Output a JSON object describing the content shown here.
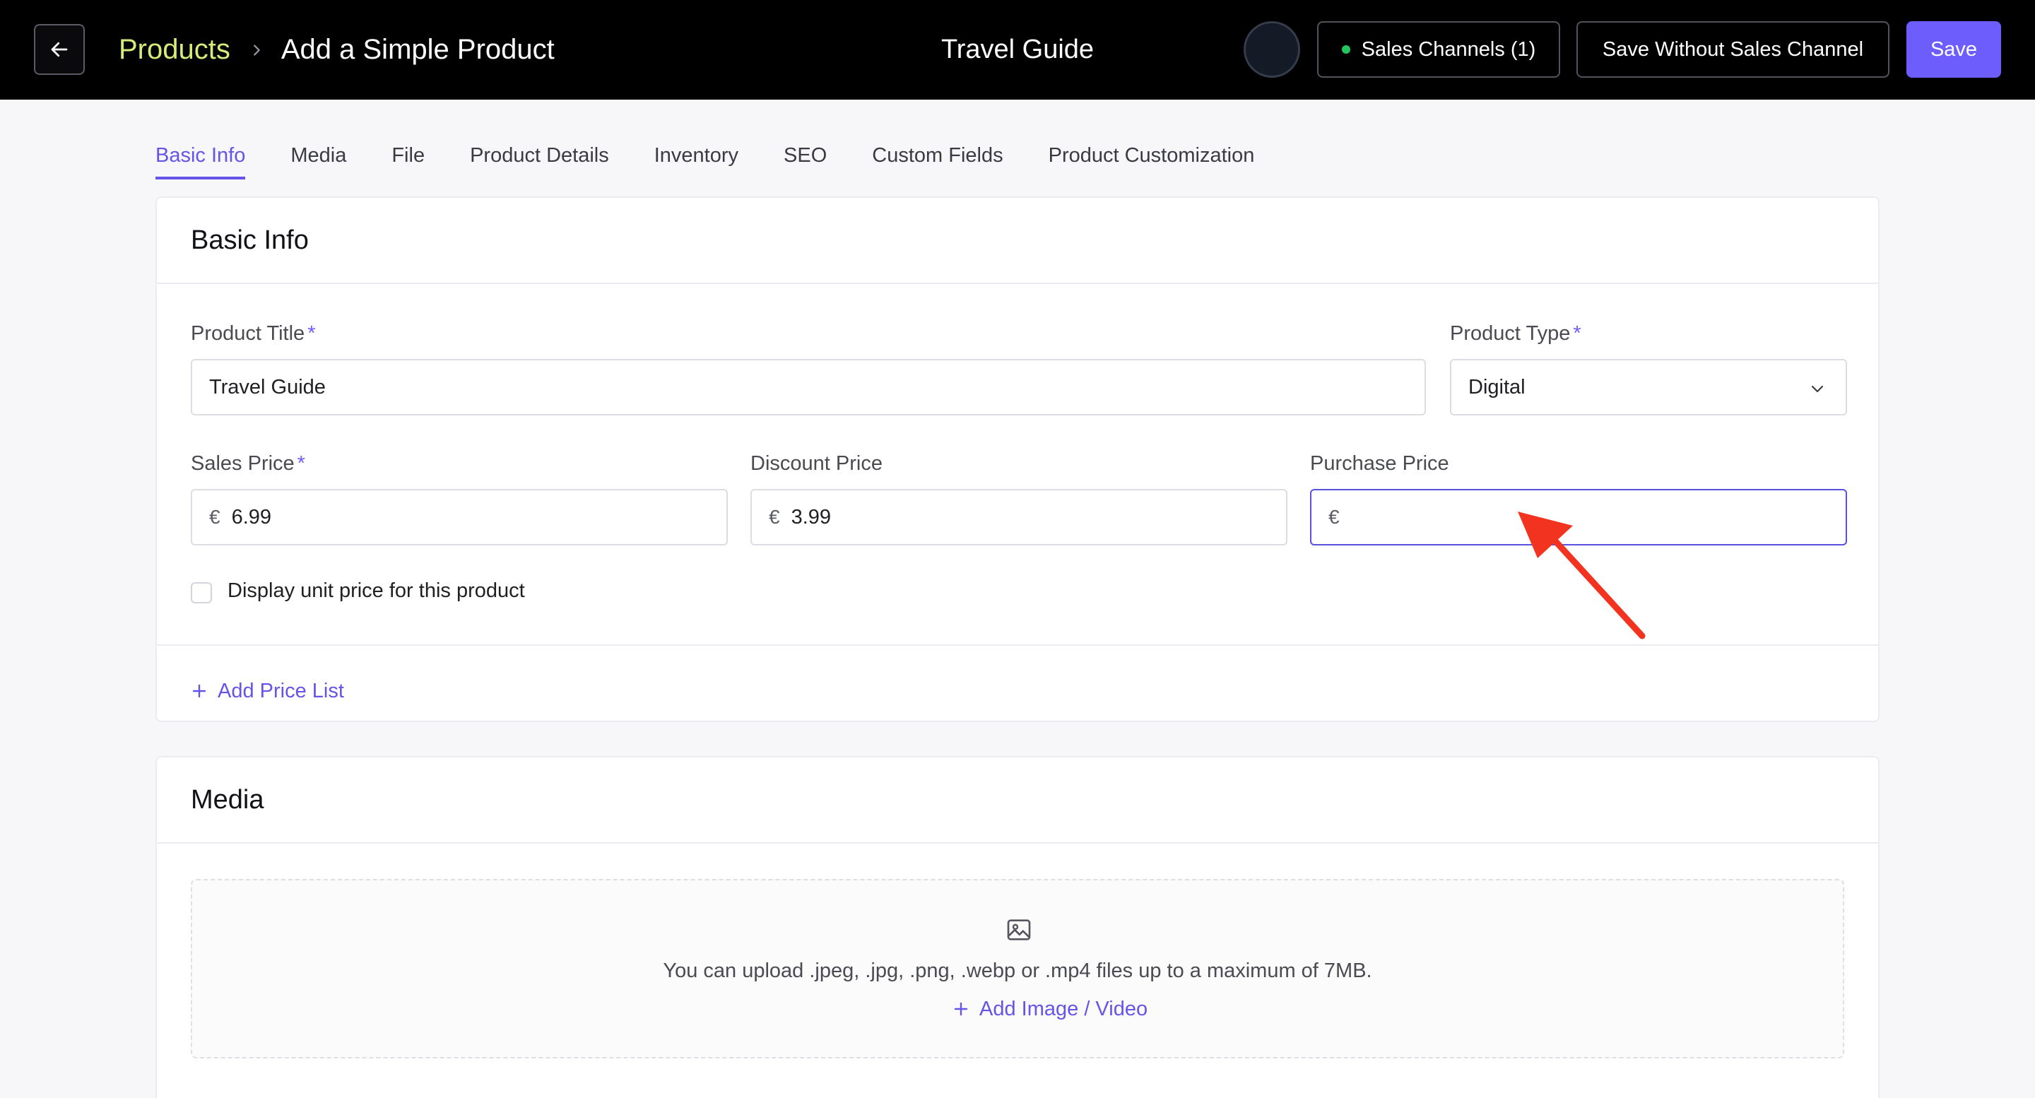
{
  "header": {
    "back_icon": "arrow-left-icon",
    "breadcrumb_parent": "Products",
    "breadcrumb_separator_icon": "chevron-right-icon",
    "breadcrumb_current": "Add a Simple Product",
    "center_title": "Travel Guide",
    "sales_channels_label": "Sales Channels (1)",
    "save_without_label": "Save Without Sales Channel",
    "save_label": "Save"
  },
  "tabs": [
    {
      "label": "Basic Info",
      "active": true
    },
    {
      "label": "Media",
      "active": false
    },
    {
      "label": "File",
      "active": false
    },
    {
      "label": "Product Details",
      "active": false
    },
    {
      "label": "Inventory",
      "active": false
    },
    {
      "label": "SEO",
      "active": false
    },
    {
      "label": "Custom Fields",
      "active": false
    },
    {
      "label": "Product Customization",
      "active": false
    }
  ],
  "basic_info": {
    "title": "Basic Info",
    "required_mark": "*",
    "product_title": {
      "label": "Product Title",
      "value": "Travel Guide"
    },
    "product_type": {
      "label": "Product Type",
      "value": "Digital"
    },
    "sales_price": {
      "label": "Sales Price",
      "currency": "€",
      "value": "6.99"
    },
    "discount_price": {
      "label": "Discount Price",
      "currency": "€",
      "value": "3.99"
    },
    "purchase_price": {
      "label": "Purchase Price",
      "currency": "€",
      "value": ""
    },
    "unit_price_checkbox": {
      "label": "Display unit price for this product",
      "checked": false
    },
    "add_price_list_label": "Add Price List"
  },
  "media": {
    "title": "Media",
    "upload_hint": "You can upload .jpeg, .jpg, .png, .webp or .mp4 files up to a maximum of 7MB.",
    "add_media_label": "Add Image / Video"
  },
  "colors": {
    "accent": "#6d5dfc",
    "breadcrumb_link": "#d6ec7a",
    "status_dot": "#22c55e",
    "annotation_arrow": "#f2331f"
  }
}
